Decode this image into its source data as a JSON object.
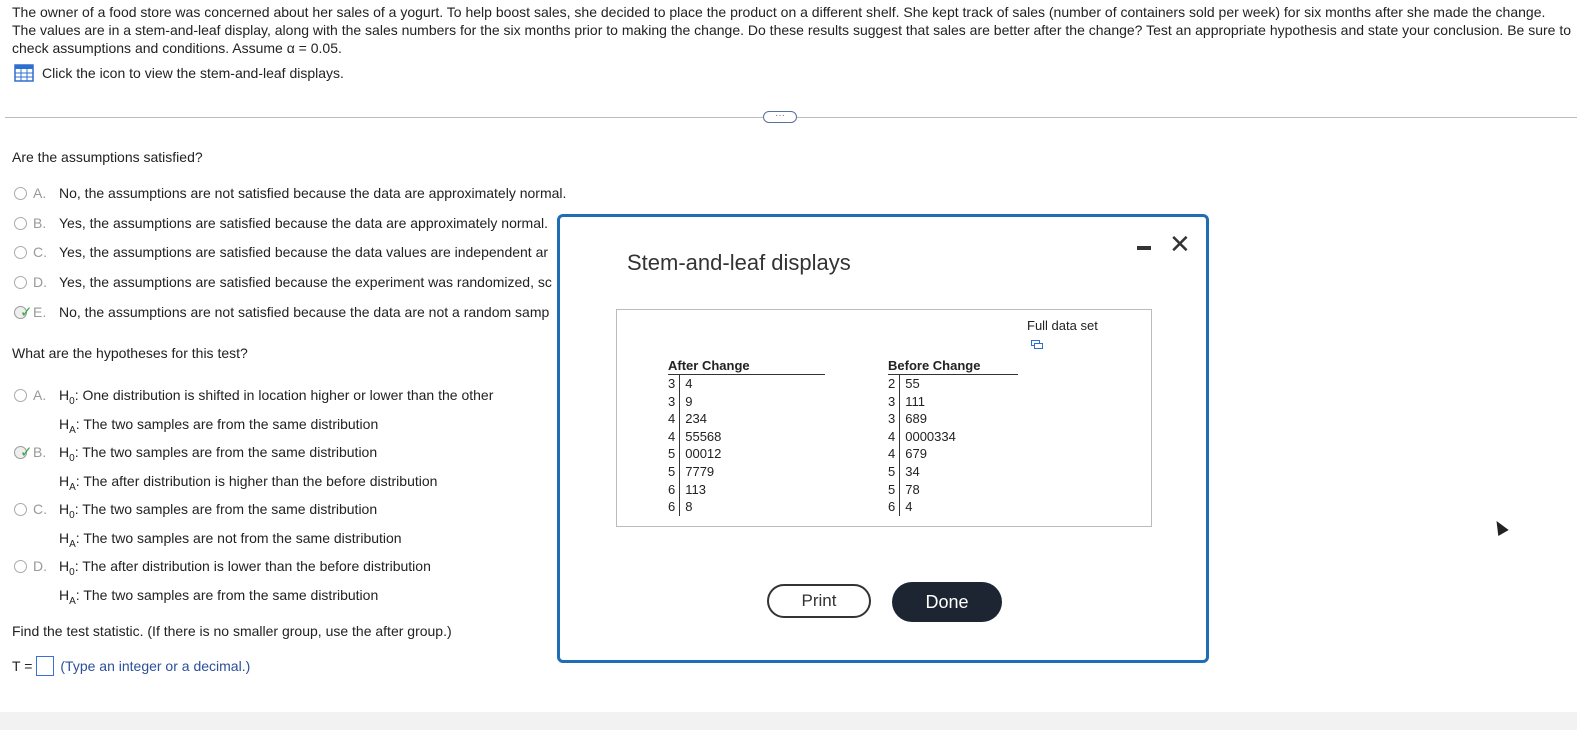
{
  "question": {
    "text": "The owner of a food store was concerned about her sales of a yogurt. To help boost sales, she decided to place the product on a different shelf. She kept track of sales (number of containers sold per week) for six months after she made the change. The values are in a stem-and-leaf display, along with the sales numbers for the six months prior to making the change. Do these results suggest that sales are better after the change? Test an appropriate hypothesis and state your conclusion. Be sure to check assumptions and conditions. Assume α = 0.05.",
    "view_link": "Click the icon to view the stem-and-leaf displays.",
    "view_icon": "table-icon"
  },
  "assumptions": {
    "prompt": "Are the assumptions satisfied?",
    "options": [
      {
        "letter": "A.",
        "text": "No, the assumptions are not satisfied because the data are approximately normal."
      },
      {
        "letter": "B.",
        "text": "Yes, the assumptions are satisfied because the data are approximately normal."
      },
      {
        "letter": "C.",
        "text": "Yes, the assumptions are satisfied because the data values are independent ar"
      },
      {
        "letter": "D.",
        "text": "Yes, the assumptions are satisfied because the experiment was randomized, sc"
      },
      {
        "letter": "E.",
        "text": "No, the assumptions are not satisfied because the data are not a random samp"
      }
    ],
    "selected": "E."
  },
  "hypotheses": {
    "prompt": "What are the hypotheses for this test?",
    "options": [
      {
        "letter": "A.",
        "h0": "One distribution is shifted in location higher or lower than the other",
        "ha": "The two samples are from the same distribution"
      },
      {
        "letter": "B.",
        "h0": "The two samples are from the same distribution",
        "ha": "The after distribution is higher than the before distribution"
      },
      {
        "letter": "C.",
        "h0": "The two samples are from the same distribution",
        "ha": "The two samples are not from the same distribution"
      },
      {
        "letter": "D.",
        "h0": "The after distribution is lower than the before distribution",
        "ha": "The two samples are from the same distribution"
      }
    ],
    "selected": "B.",
    "h0_label": "H",
    "h0_sub": "0",
    "ha_label": "H",
    "ha_sub": "A",
    "colon": ":"
  },
  "statistic": {
    "prompt": "Find the test statistic. (If there is no smaller group, use the after group.)",
    "label": "T =",
    "value": "",
    "hint": "(Type an integer or a decimal.)"
  },
  "modal": {
    "title": "Stem-and-leaf displays",
    "full_data_label": "Full data set",
    "full_data_icon": "copy-icon",
    "minimize_icon": "minimize-icon",
    "close_icon": "close-icon",
    "close_glyph": "✕",
    "print_label": "Print",
    "done_label": "Done",
    "after": {
      "title": "After Change",
      "rows": [
        {
          "stem": "3",
          "leaves": "4"
        },
        {
          "stem": "3",
          "leaves": "9"
        },
        {
          "stem": "4",
          "leaves": "234"
        },
        {
          "stem": "4",
          "leaves": "55568"
        },
        {
          "stem": "5",
          "leaves": "00012"
        },
        {
          "stem": "5",
          "leaves": "7779"
        },
        {
          "stem": "6",
          "leaves": "113"
        },
        {
          "stem": "6",
          "leaves": "8"
        }
      ]
    },
    "before": {
      "title": "Before Change",
      "rows": [
        {
          "stem": "2",
          "leaves": "55"
        },
        {
          "stem": "3",
          "leaves": "111"
        },
        {
          "stem": "3",
          "leaves": "689"
        },
        {
          "stem": "4",
          "leaves": "0000334"
        },
        {
          "stem": "4",
          "leaves": "679"
        },
        {
          "stem": "5",
          "leaves": "34"
        },
        {
          "stem": "5",
          "leaves": "78"
        },
        {
          "stem": "6",
          "leaves": "4"
        }
      ]
    }
  },
  "colors": {
    "accent": "#1e6eb5",
    "check": "#3aa84a",
    "done_bg": "#1d2432"
  }
}
